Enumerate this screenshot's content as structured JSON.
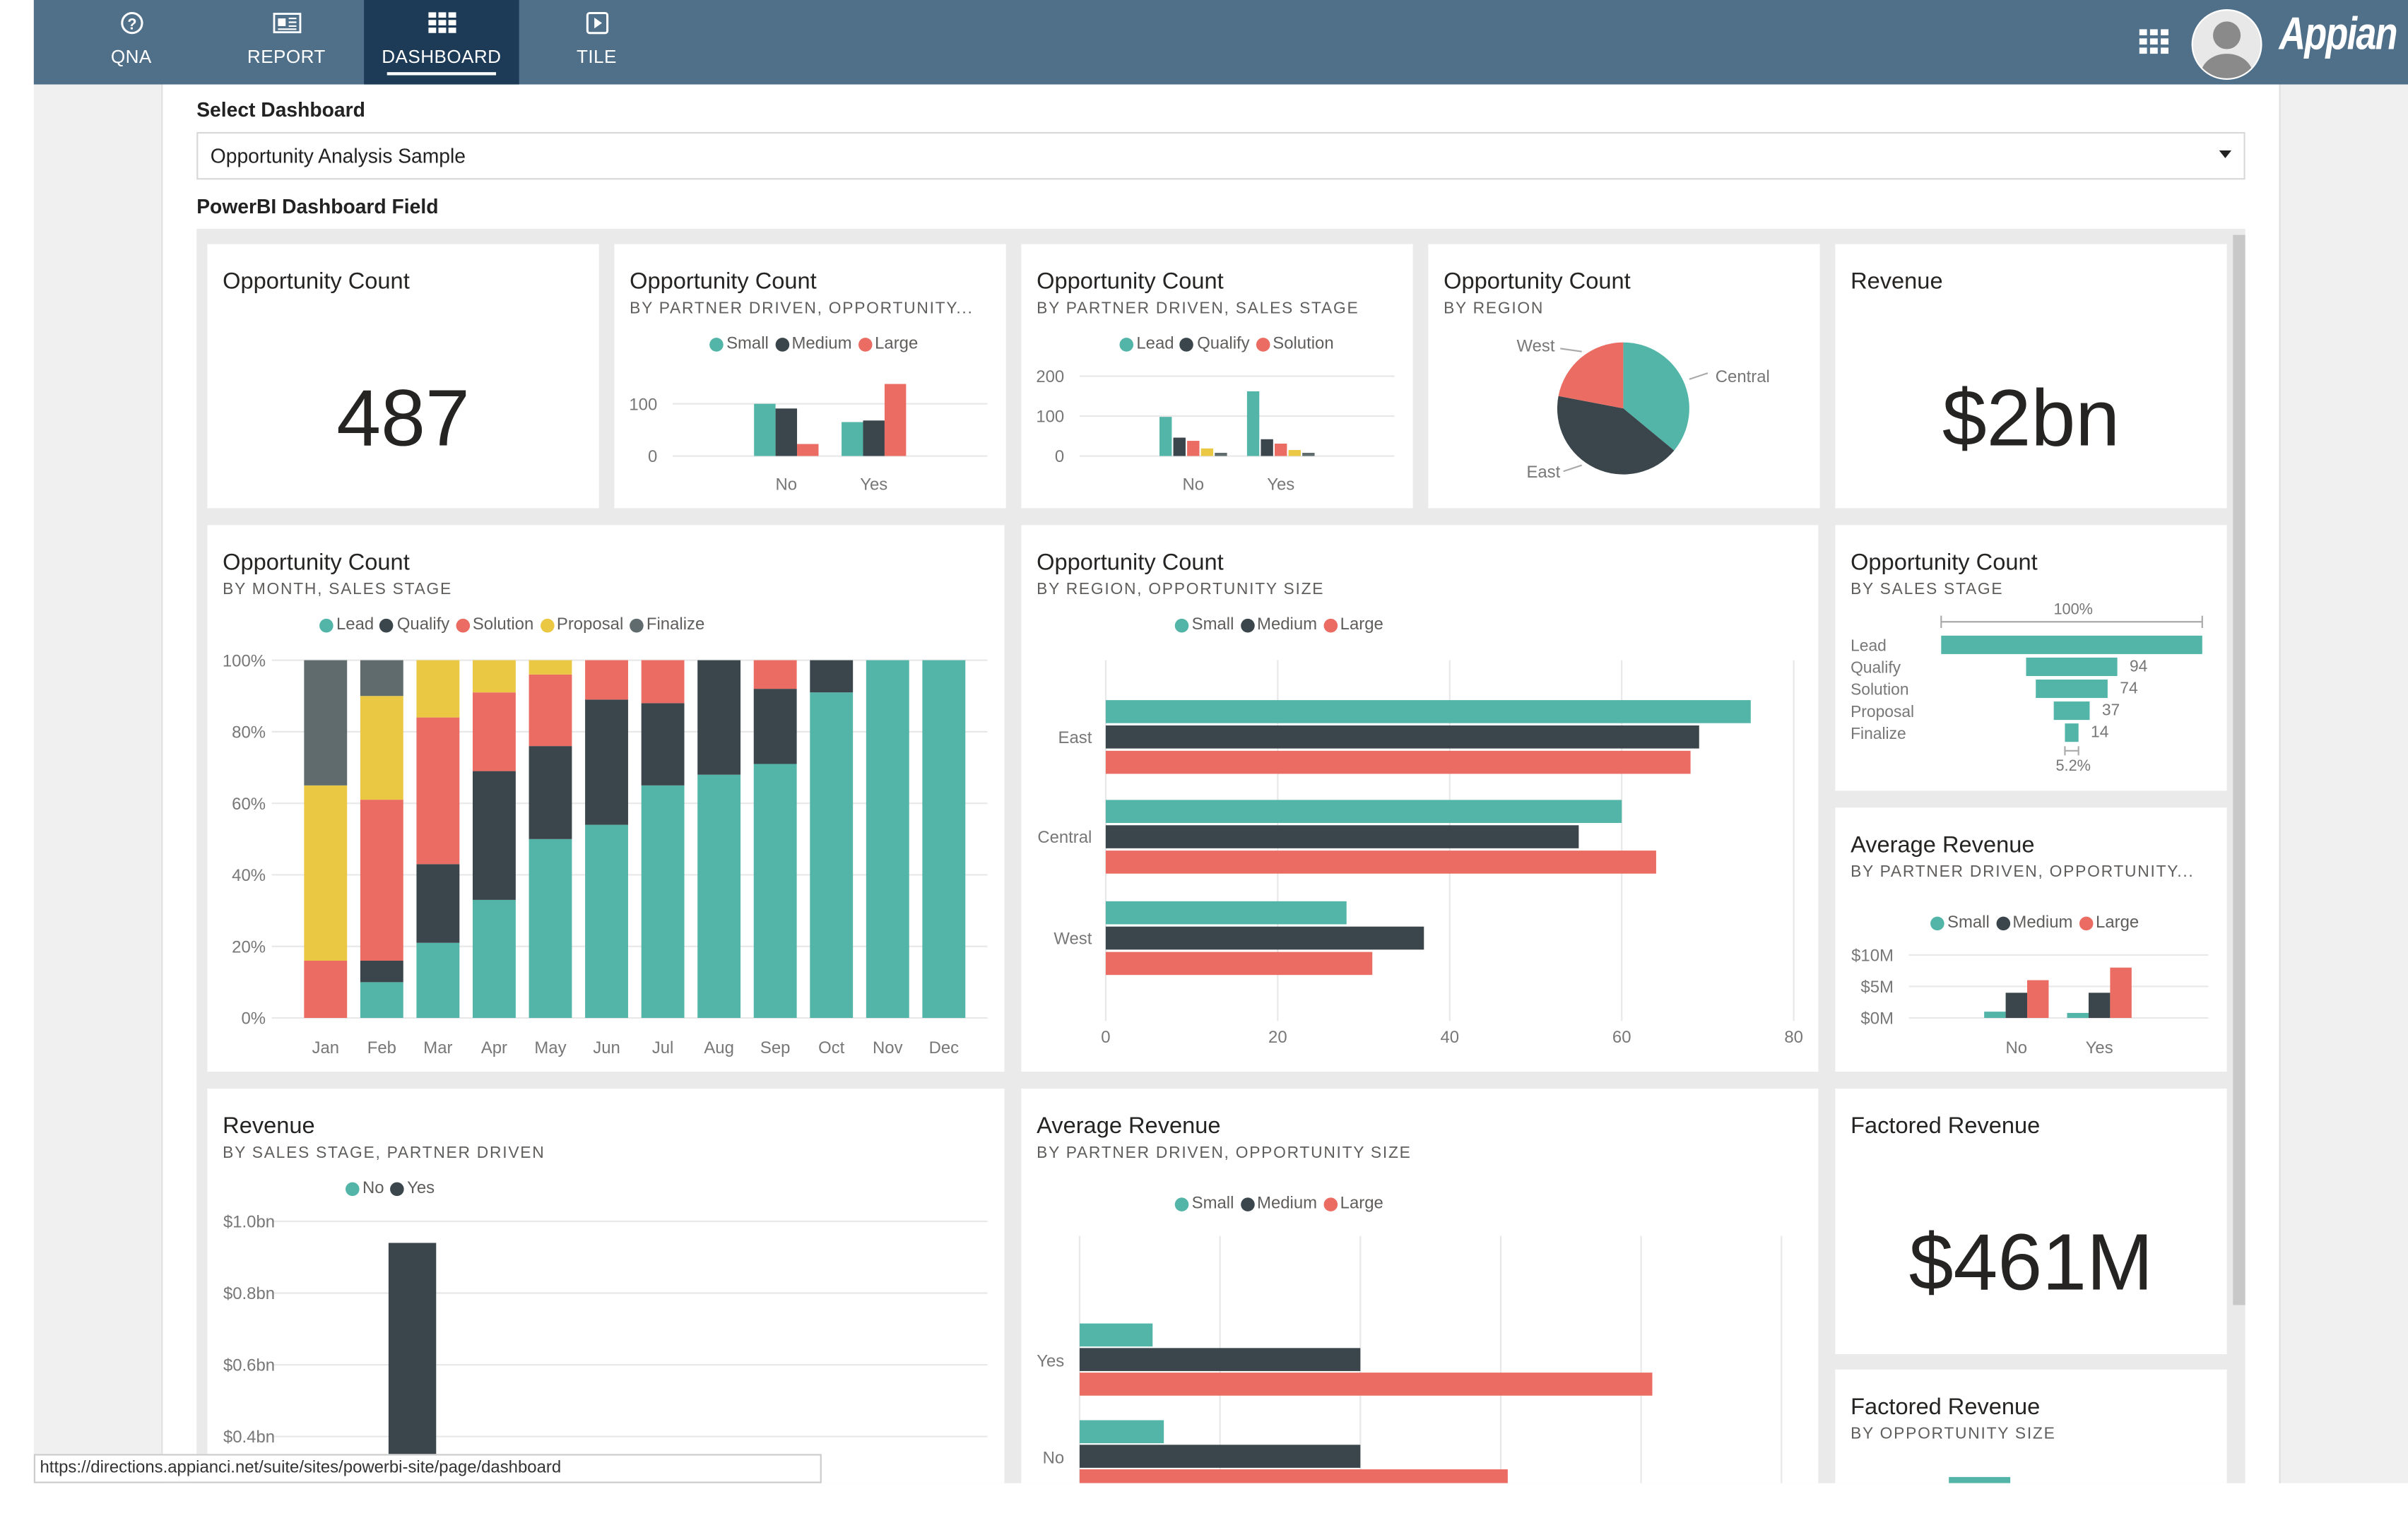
{
  "nav": {
    "tabs": [
      {
        "label": "QNA",
        "icon": "question-circle-icon"
      },
      {
        "label": "REPORT",
        "icon": "report-icon"
      },
      {
        "label": "DASHBOARD",
        "icon": "grid-icon",
        "active": true
      },
      {
        "label": "TILE",
        "icon": "play-square-icon"
      }
    ],
    "logo": "Appian",
    "apps_icon": "apps-grid-icon",
    "avatar_icon": "user-avatar-icon",
    "color": "#50708a",
    "active_color": "#1d3a56"
  },
  "form": {
    "select_label": "Select Dashboard",
    "select_value": "Opportunity Analysis Sample",
    "field_label": "PowerBI Dashboard Field"
  },
  "colors": {
    "teal": "#52b5a8",
    "dark": "#3b464c",
    "red": "#eb6c62",
    "yellow": "#ebc844",
    "grey": "#5f6b6d"
  },
  "tiles": {
    "opp_count": {
      "title": "Opportunity Count",
      "value": "487"
    },
    "revenue": {
      "title": "Revenue",
      "value": "$2bn"
    },
    "factored": {
      "title": "Factored Revenue",
      "value": "$461M"
    }
  },
  "legends": {
    "size": [
      "Small",
      "Medium",
      "Large"
    ],
    "stage3": [
      "Lead",
      "Qualify",
      "Solution"
    ],
    "stage5": [
      "Lead",
      "Qualify",
      "Solution",
      "Proposal",
      "Finalize"
    ],
    "partner": [
      "No",
      "Yes"
    ]
  },
  "chart_data": [
    {
      "id": "c2",
      "type": "bar",
      "title": "Opportunity Count",
      "subtitle": "BY PARTNER DRIVEN, OPPORTUNITY...",
      "categories": [
        "No",
        "Yes"
      ],
      "yticks": [
        "0",
        "100"
      ],
      "ylim": [
        0,
        100
      ],
      "grid": true,
      "legend": "top",
      "series": [
        {
          "name": "Small",
          "values": [
            100,
            65
          ]
        },
        {
          "name": "Medium",
          "values": [
            91,
            68
          ]
        },
        {
          "name": "Large",
          "values": [
            23,
            138
          ]
        }
      ]
    },
    {
      "id": "c3",
      "type": "bar",
      "title": "Opportunity Count",
      "subtitle": "BY PARTNER DRIVEN, SALES STAGE",
      "categories": [
        "No",
        "Yes"
      ],
      "yticks": [
        "0",
        "100",
        "200"
      ],
      "ylim": [
        0,
        200
      ],
      "grid": true,
      "legend": "top",
      "series": [
        {
          "name": "Lead",
          "values": [
            98,
            162
          ]
        },
        {
          "name": "Qualify",
          "values": [
            46,
            42
          ]
        },
        {
          "name": "Solution",
          "values": [
            38,
            31
          ]
        },
        {
          "name": "Proposal",
          "values": [
            19,
            15
          ]
        },
        {
          "name": "Finalize",
          "values": [
            8,
            8
          ]
        }
      ]
    },
    {
      "id": "c4",
      "type": "pie",
      "title": "Opportunity Count",
      "subtitle": "BY REGION",
      "labels": [
        "Central",
        "East",
        "West"
      ],
      "values": [
        36,
        42,
        22
      ]
    },
    {
      "id": "c6",
      "type": "bar",
      "stacked": "100%",
      "title": "Opportunity Count",
      "subtitle": "BY MONTH, SALES STAGE",
      "categories": [
        "Jan",
        "Feb",
        "Mar",
        "Apr",
        "May",
        "Jun",
        "Jul",
        "Aug",
        "Sep",
        "Oct",
        "Nov",
        "Dec"
      ],
      "yticks": [
        "0%",
        "20%",
        "40%",
        "60%",
        "80%",
        "100%"
      ],
      "ylim": [
        0,
        100
      ],
      "grid": true,
      "legend": "top",
      "series": [
        {
          "name": "Lead",
          "values": [
            0,
            10,
            21,
            33,
            50,
            54,
            65,
            68,
            71,
            91,
            100,
            100
          ]
        },
        {
          "name": "Qualify",
          "values": [
            0,
            6,
            22,
            36,
            26,
            35,
            23,
            32,
            21,
            9,
            0,
            0
          ]
        },
        {
          "name": "Solution",
          "values": [
            16,
            45,
            41,
            22,
            20,
            11,
            12,
            0,
            8,
            0,
            0,
            0
          ]
        },
        {
          "name": "Proposal",
          "values": [
            49,
            29,
            16,
            9,
            4,
            0,
            0,
            0,
            0,
            0,
            0,
            0
          ]
        },
        {
          "name": "Finalize",
          "values": [
            35,
            10,
            0,
            0,
            0,
            0,
            0,
            0,
            0,
            0,
            0,
            0
          ]
        }
      ]
    },
    {
      "id": "c7",
      "type": "bar",
      "orientation": "horizontal",
      "title": "Opportunity Count",
      "subtitle": "BY REGION, OPPORTUNITY SIZE",
      "categories": [
        "East",
        "Central",
        "West"
      ],
      "xticks": [
        "0",
        "20",
        "40",
        "60",
        "80"
      ],
      "xlim": [
        0,
        80
      ],
      "grid": true,
      "legend": "top",
      "series": [
        {
          "name": "Small",
          "values": [
            75,
            60,
            28
          ]
        },
        {
          "name": "Medium",
          "values": [
            69,
            55,
            37
          ]
        },
        {
          "name": "Large",
          "values": [
            68,
            64,
            31
          ]
        }
      ]
    },
    {
      "id": "c8",
      "type": "funnel",
      "title": "Opportunity Count",
      "subtitle": "BY SALES STAGE",
      "categories": [
        "Lead",
        "Qualify",
        "Solution",
        "Proposal",
        "Finalize"
      ],
      "values": [
        269,
        94,
        74,
        37,
        14
      ],
      "value_labels": [
        "",
        "94",
        "74",
        "37",
        "14"
      ],
      "top_label": "100%",
      "bottom_label": "5.2%"
    },
    {
      "id": "c9",
      "type": "bar",
      "title": "Average Revenue",
      "subtitle": "BY PARTNER DRIVEN, OPPORTUNITY...",
      "categories": [
        "No",
        "Yes"
      ],
      "yticks": [
        "$0M",
        "$5M",
        "$10M"
      ],
      "ylim": [
        0,
        10
      ],
      "grid": true,
      "legend": "top",
      "series": [
        {
          "name": "Small",
          "values": [
            1,
            0.8
          ]
        },
        {
          "name": "Medium",
          "values": [
            4,
            4
          ]
        },
        {
          "name": "Large",
          "values": [
            6,
            8
          ]
        }
      ]
    },
    {
      "id": "c10",
      "type": "bar",
      "title": "Revenue",
      "subtitle": "BY SALES STAGE, PARTNER DRIVEN",
      "yticks": [
        "$0.4bn",
        "$0.6bn",
        "$0.8bn",
        "$1.0bn"
      ],
      "grid": true,
      "legend": "top",
      "series": [
        {
          "name": "No",
          "values": []
        },
        {
          "name": "Yes",
          "values": [
            0.94
          ]
        }
      ]
    },
    {
      "id": "c11",
      "type": "bar",
      "orientation": "horizontal",
      "title": "Average Revenue",
      "subtitle": "BY PARTNER DRIVEN, OPPORTUNITY SIZE",
      "categories": [
        "Yes",
        "No"
      ],
      "grid": true,
      "legend": "top",
      "series": [
        {
          "name": "Small",
          "values": [
            0.52,
            0.6
          ]
        },
        {
          "name": "Medium",
          "values": [
            2,
            2
          ]
        },
        {
          "name": "Large",
          "values": [
            4.08,
            3.05
          ]
        }
      ]
    },
    {
      "id": "c13",
      "type": "bar",
      "title": "Factored Revenue",
      "subtitle": "BY OPPORTUNITY SIZE"
    }
  ],
  "status_url": "https://directions.appianci.net/suite/sites/powerbi-site/page/dashboard"
}
